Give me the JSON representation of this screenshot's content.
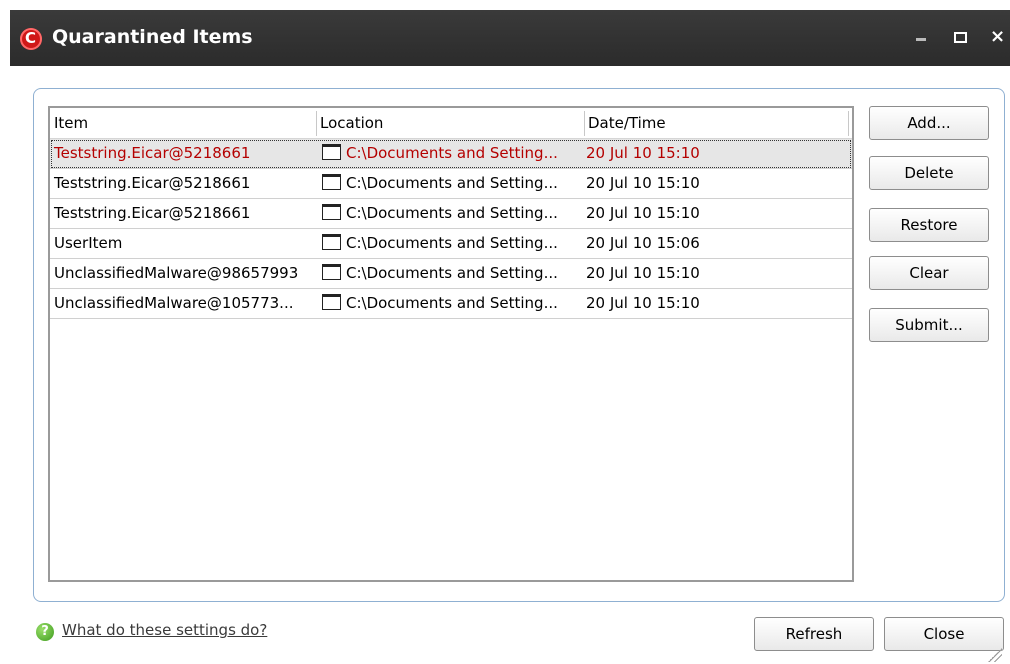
{
  "window": {
    "title": "Quarantined Items",
    "controls": {
      "minimize": "minimize",
      "maximize": "maximize",
      "close": "×"
    }
  },
  "table": {
    "columns": [
      "Item",
      "Location",
      "Date/Time"
    ],
    "rows": [
      {
        "item": "Teststring.Eicar@5218661",
        "location": "C:\\Documents and Setting...",
        "datetime": "20 Jul 10 15:10",
        "selected": true
      },
      {
        "item": "Teststring.Eicar@5218661",
        "location": "C:\\Documents and Setting...",
        "datetime": "20 Jul 10 15:10",
        "selected": false
      },
      {
        "item": "Teststring.Eicar@5218661",
        "location": "C:\\Documents and Setting...",
        "datetime": "20 Jul 10 15:10",
        "selected": false
      },
      {
        "item": "UserItem",
        "location": "C:\\Documents and Setting...",
        "datetime": "20 Jul 10 15:06",
        "selected": false
      },
      {
        "item": "UnclassifiedMalware@98657993",
        "location": "C:\\Documents and Setting...",
        "datetime": "20 Jul 10 15:10",
        "selected": false
      },
      {
        "item": "UnclassifiedMalware@105773...",
        "location": "C:\\Documents and Setting...",
        "datetime": "20 Jul 10 15:10",
        "selected": false
      }
    ]
  },
  "side_buttons": {
    "add": "Add...",
    "delete": "Delete",
    "restore": "Restore",
    "clear": "Clear",
    "submit": "Submit..."
  },
  "footer": {
    "help_link": "What do these settings do?",
    "refresh": "Refresh",
    "close": "Close"
  },
  "colors": {
    "selected_text": "#b40000",
    "titlebar": "#2f2f2f",
    "panel_border": "#8fb0d2"
  },
  "icons": {
    "app": "comodo-shield-icon",
    "location": "window-icon",
    "help": "help-icon"
  }
}
